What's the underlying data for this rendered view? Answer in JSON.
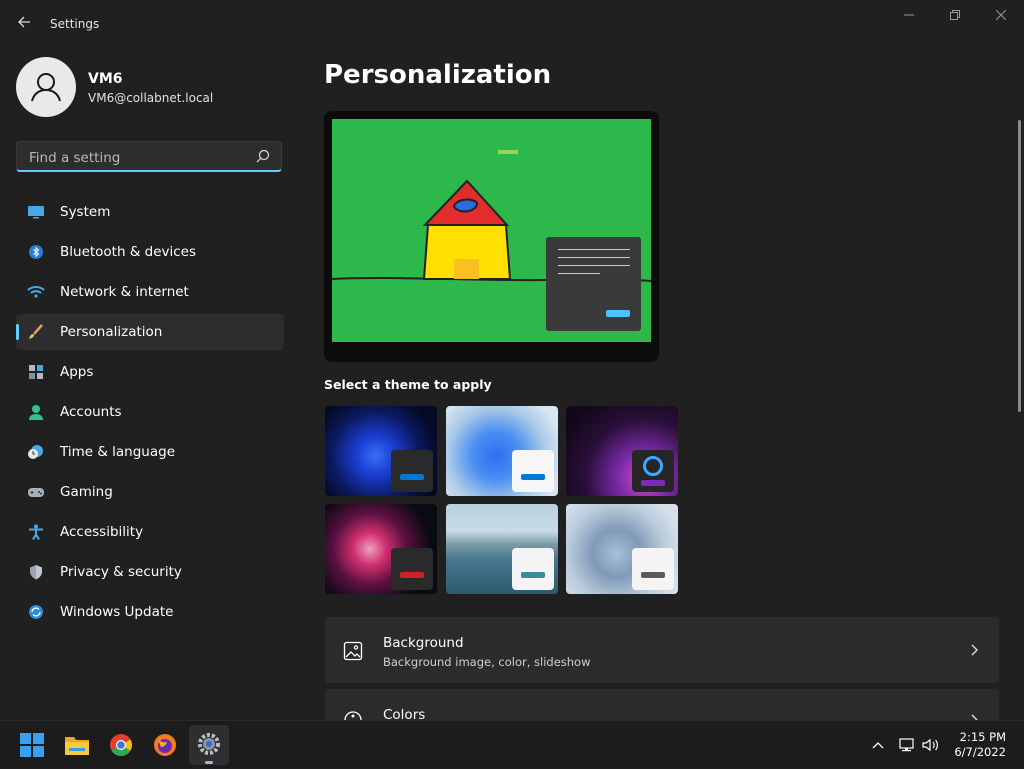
{
  "window": {
    "title": "Settings"
  },
  "profile": {
    "name": "VM6",
    "email": "VM6@collabnet.local"
  },
  "search": {
    "placeholder": "Find a setting"
  },
  "sidebar": {
    "items": [
      {
        "label": "System",
        "icon": "system-icon"
      },
      {
        "label": "Bluetooth & devices",
        "icon": "bluetooth-icon"
      },
      {
        "label": "Network & internet",
        "icon": "wifi-icon"
      },
      {
        "label": "Personalization",
        "icon": "brush-icon",
        "active": true
      },
      {
        "label": "Apps",
        "icon": "apps-icon"
      },
      {
        "label": "Accounts",
        "icon": "accounts-icon"
      },
      {
        "label": "Time & language",
        "icon": "clock-globe-icon"
      },
      {
        "label": "Gaming",
        "icon": "gamepad-icon"
      },
      {
        "label": "Accessibility",
        "icon": "accessibility-icon"
      },
      {
        "label": "Privacy & security",
        "icon": "shield-icon"
      },
      {
        "label": "Windows Update",
        "icon": "update-icon"
      }
    ]
  },
  "main": {
    "title": "Personalization",
    "themes_heading": "Select a theme to apply",
    "cards": [
      {
        "title": "Background",
        "subtitle": "Background image, color, slideshow",
        "icon": "image-icon"
      },
      {
        "title": "Colors",
        "subtitle": "",
        "icon": "palette-icon"
      }
    ]
  },
  "colors": {
    "accent": "#60cdff",
    "wallpaper": "#2db84b"
  },
  "taskbar": {
    "apps": [
      "start-icon",
      "file-explorer-icon",
      "chrome-icon",
      "firefox-icon",
      "settings-icon"
    ],
    "time": "2:15 PM",
    "date": "6/7/2022"
  }
}
